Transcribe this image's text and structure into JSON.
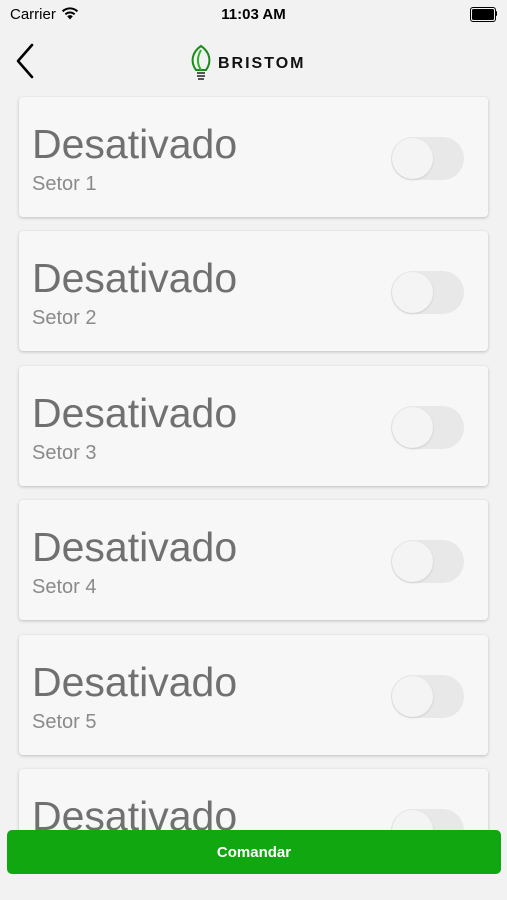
{
  "status_bar": {
    "carrier": "Carrier",
    "time": "11:03 AM"
  },
  "nav": {
    "logo_text": "BRISTOM"
  },
  "sectors": [
    {
      "state": "Desativado",
      "name": "Setor 1",
      "enabled": false
    },
    {
      "state": "Desativado",
      "name": "Setor 2",
      "enabled": false
    },
    {
      "state": "Desativado",
      "name": "Setor 3",
      "enabled": false
    },
    {
      "state": "Desativado",
      "name": "Setor 4",
      "enabled": false
    },
    {
      "state": "Desativado",
      "name": "Setor 5",
      "enabled": false
    },
    {
      "state": "Desativado",
      "name": "",
      "enabled": false
    }
  ],
  "command_button": {
    "label": "Comandar",
    "color": "#10a710"
  }
}
